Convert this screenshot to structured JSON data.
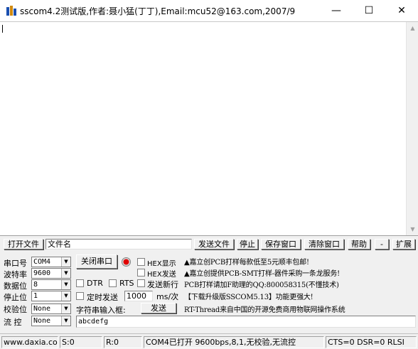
{
  "window": {
    "title": "sscom4.2测试版,作者:聂小猛(丁丁),Email:mcu52@163.com,2007/9",
    "minimize": "—",
    "maximize": "☐",
    "close": "✕"
  },
  "toolbar": {
    "open_file": "打开文件",
    "file_name": "文件名",
    "send_file": "发送文件",
    "stop": "停止",
    "save_window": "保存窗口",
    "clear_window": "清除窗口",
    "help": "帮助",
    "minus": "-",
    "expand": "扩展"
  },
  "settings": {
    "port_label": "串口号",
    "port_value": "COM4",
    "baud_label": "波特率",
    "baud_value": "9600",
    "databits_label": "数据位",
    "databits_value": "8",
    "stopbits_label": "停止位",
    "stopbits_value": "1",
    "parity_label": "校验位",
    "parity_value": "None",
    "flow_label": "流 控",
    "flow_value": "None"
  },
  "controls": {
    "close_port": "关闭串口",
    "hex_display": "HEX显示",
    "hex_send": "HEX发送",
    "dtr": "DTR",
    "rts": "RTS",
    "send_newline": "发送新行",
    "timed_send": "定时发送",
    "interval_value": "1000",
    "interval_unit": "ms/次",
    "string_input": "字符串输入框:",
    "send": "发送",
    "send_text": "abcdefg"
  },
  "ads": [
    "▲嘉立创PCB打样每款低至5元顺丰包邮!",
    "▲嘉立创提供PCB-SMT打样-器件采购一条龙服务!",
    "PCB打样请加F助理的QQ:800058315(不懂技术)",
    "【下载升级版SSCOM5.13】功能更强大!",
    "RT-Thread来自中国的开源免费商用物联网操作系统"
  ],
  "status": {
    "website": "www.daxia.cor",
    "sent": "S:0",
    "received": "R:0",
    "port_state": "COM4已打开  9600bps,8,1,无校验,无流控",
    "lines": "CTS=0 DSR=0 RLSI"
  },
  "colors": {
    "led": "#e00000",
    "window_bg": "#f0f0f0"
  }
}
